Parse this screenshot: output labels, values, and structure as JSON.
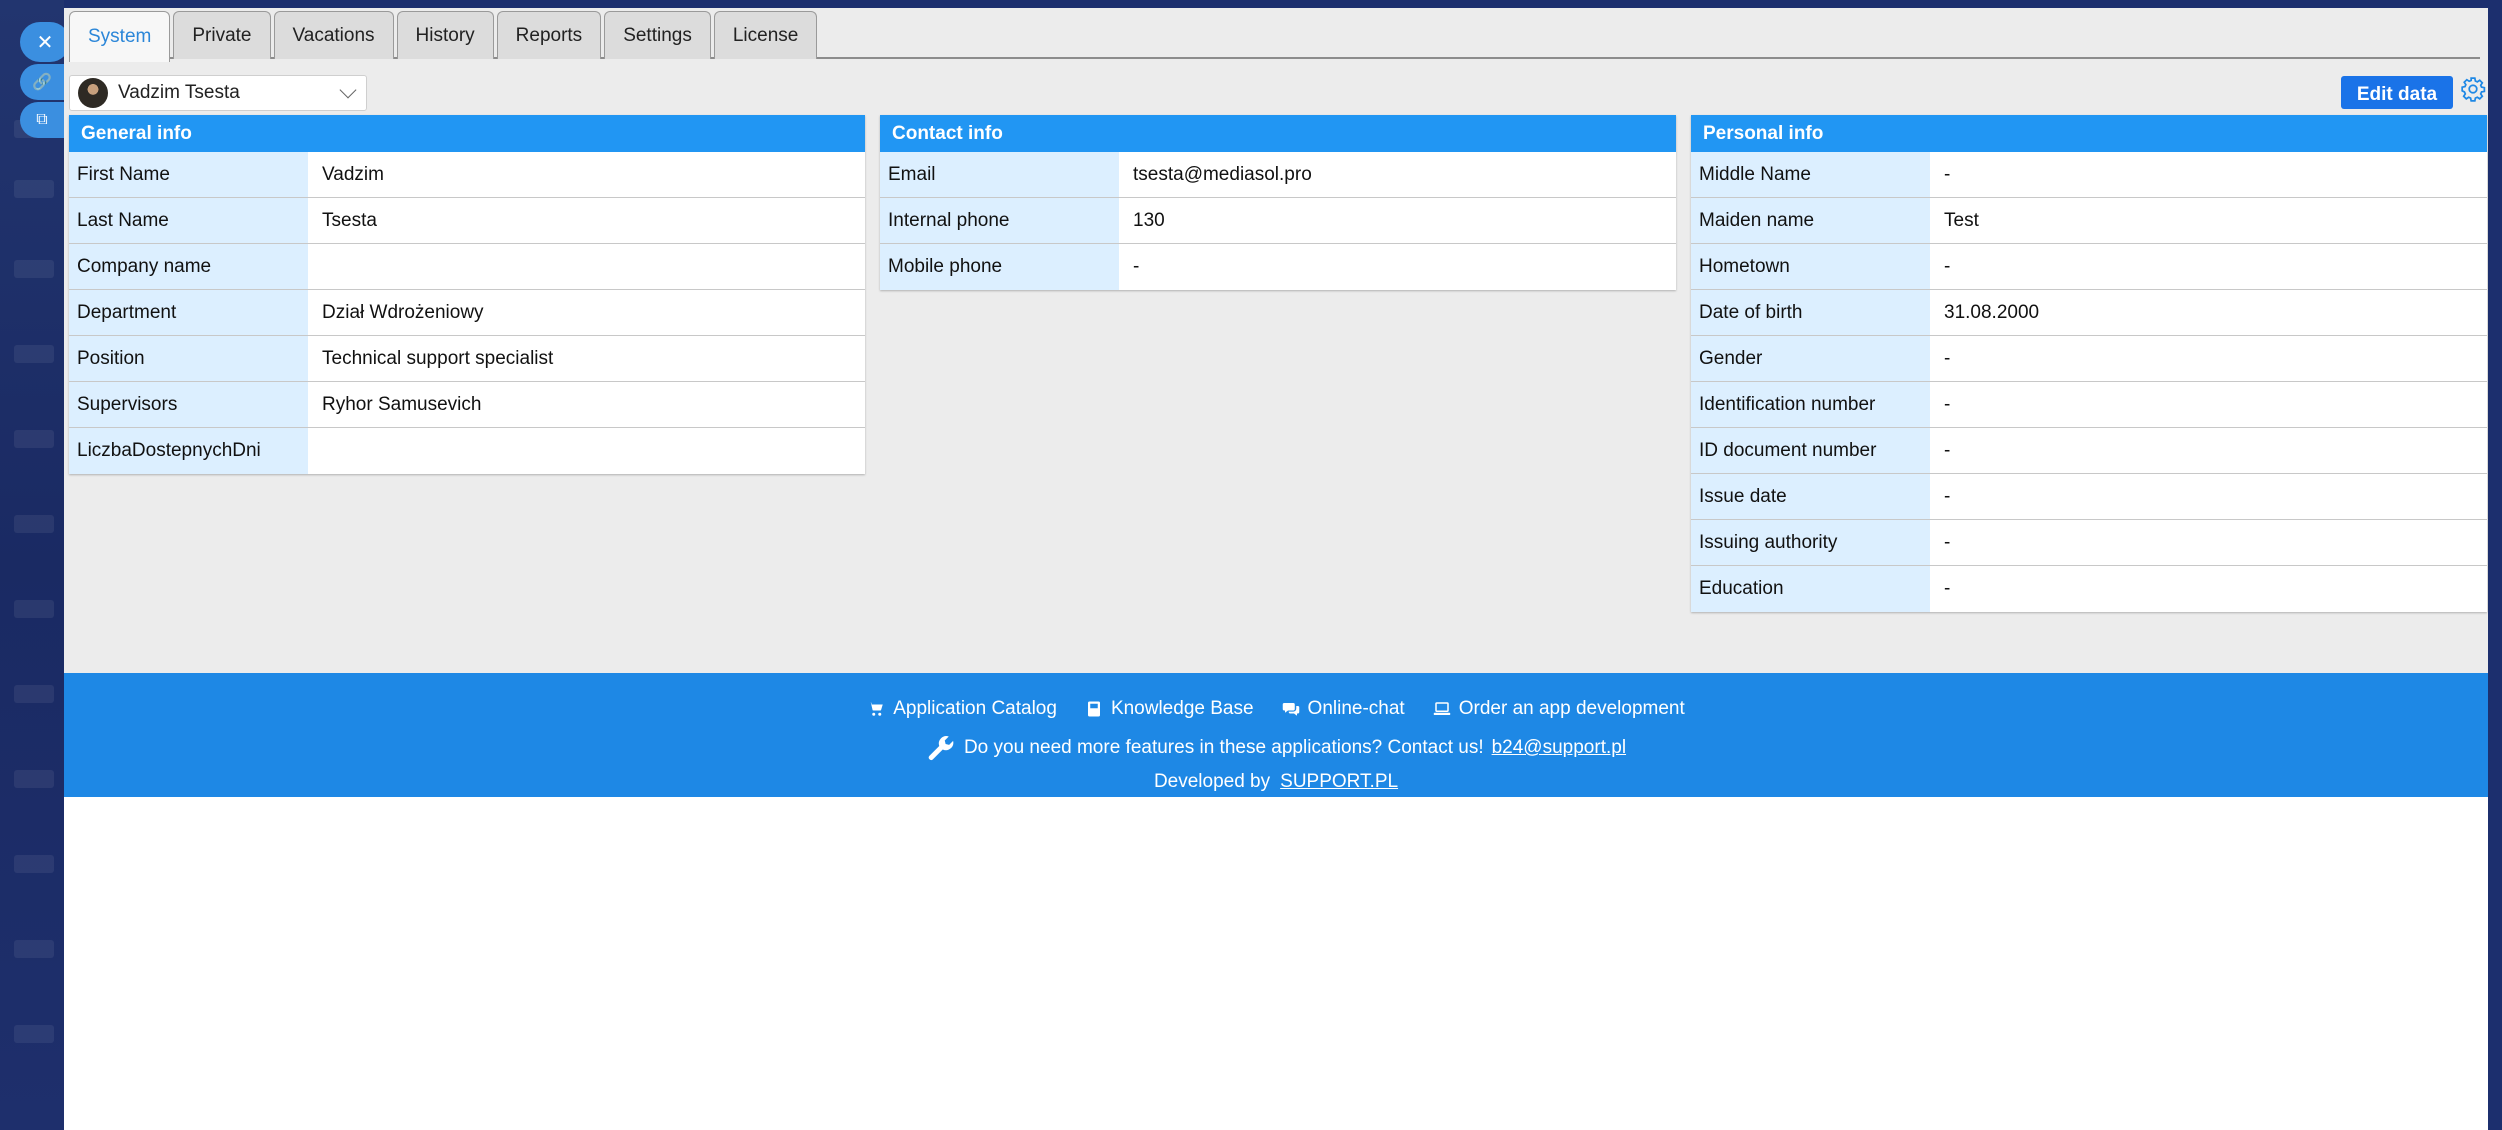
{
  "tabs": [
    {
      "label": "System",
      "active": true
    },
    {
      "label": "Private"
    },
    {
      "label": "Vacations"
    },
    {
      "label": "History"
    },
    {
      "label": "Reports"
    },
    {
      "label": "Settings"
    },
    {
      "label": "License"
    }
  ],
  "user_selector": {
    "name": "Vadzim Tsesta"
  },
  "edit_button": "Edit data",
  "general_info": {
    "title": "General info",
    "rows": [
      {
        "label": "First Name",
        "value": "Vadzim"
      },
      {
        "label": "Last Name",
        "value": "Tsesta"
      },
      {
        "label": "Company name",
        "value": ""
      },
      {
        "label": "Department",
        "value": "Dział Wdrożeniowy"
      },
      {
        "label": "Position",
        "value": "Technical support specialist"
      },
      {
        "label": "Supervisors",
        "value": "Ryhor Samusevich"
      },
      {
        "label": "LiczbaDostepnychDni",
        "value": ""
      }
    ]
  },
  "contact_info": {
    "title": "Contact info",
    "rows": [
      {
        "label": "Email",
        "value": "tsesta@mediasol.pro"
      },
      {
        "label": "Internal phone",
        "value": "130"
      },
      {
        "label": "Mobile phone",
        "value": "-"
      }
    ]
  },
  "personal_info": {
    "title": "Personal info",
    "rows": [
      {
        "label": "Middle Name",
        "value": "-"
      },
      {
        "label": "Maiden name",
        "value": "Test"
      },
      {
        "label": "Hometown",
        "value": "-"
      },
      {
        "label": "Date of birth",
        "value": "31.08.2000"
      },
      {
        "label": "Gender",
        "value": "-"
      },
      {
        "label": "Identification number",
        "value": "-"
      },
      {
        "label": "ID document number",
        "value": "-"
      },
      {
        "label": "Issue date",
        "value": "-"
      },
      {
        "label": "Issuing authority",
        "value": "-"
      },
      {
        "label": "Education",
        "value": "-"
      }
    ]
  },
  "footer": {
    "links": [
      {
        "label": "Application Catalog",
        "icon": "cart-icon"
      },
      {
        "label": "Knowledge Base",
        "icon": "book-icon"
      },
      {
        "label": "Online-chat",
        "icon": "chat-icon"
      },
      {
        "label": "Order an app development",
        "icon": "laptop-icon"
      }
    ],
    "contact_text": "Do you need more features in these applications? Contact us!",
    "contact_email": "b24@support.pl",
    "developed_by": "Developed by",
    "developer": "SUPPORT.PL"
  },
  "colors": {
    "accent": "#2196f3",
    "footer_bg": "#1e88e5",
    "label_bg": "#dcefff",
    "button": "#1a73e8"
  }
}
